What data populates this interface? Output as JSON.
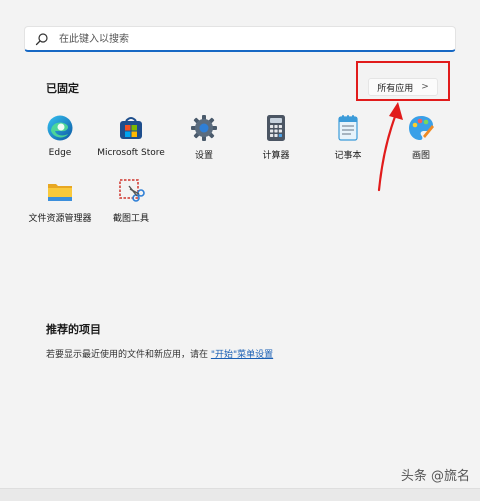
{
  "search": {
    "placeholder": "在此键入以搜索",
    "icon": "search-icon"
  },
  "pinned": {
    "title": "已固定",
    "all_apps": {
      "label": "所有应用",
      "chevron": ">"
    },
    "apps": [
      {
        "label": "Edge",
        "icon": "edge-icon"
      },
      {
        "label": "Microsoft Store",
        "icon": "store-icon"
      },
      {
        "label": "设置",
        "icon": "gear-icon"
      },
      {
        "label": "计算器",
        "icon": "calculator-icon"
      },
      {
        "label": "记事本",
        "icon": "notepad-icon"
      },
      {
        "label": "画图",
        "icon": "paint-icon"
      },
      {
        "label": "文件资源管理器",
        "icon": "folder-icon"
      },
      {
        "label": "截图工具",
        "icon": "snipping-tool-icon"
      }
    ]
  },
  "recommended": {
    "title": "推荐的项目",
    "text_before": "若要显示最近使用的文件和新应用，请在 ",
    "link": "\"开始\"菜单设置"
  },
  "watermark": "头条 @旒名",
  "colors": {
    "accent": "#1668c4",
    "highlight": "#e11b1b"
  }
}
